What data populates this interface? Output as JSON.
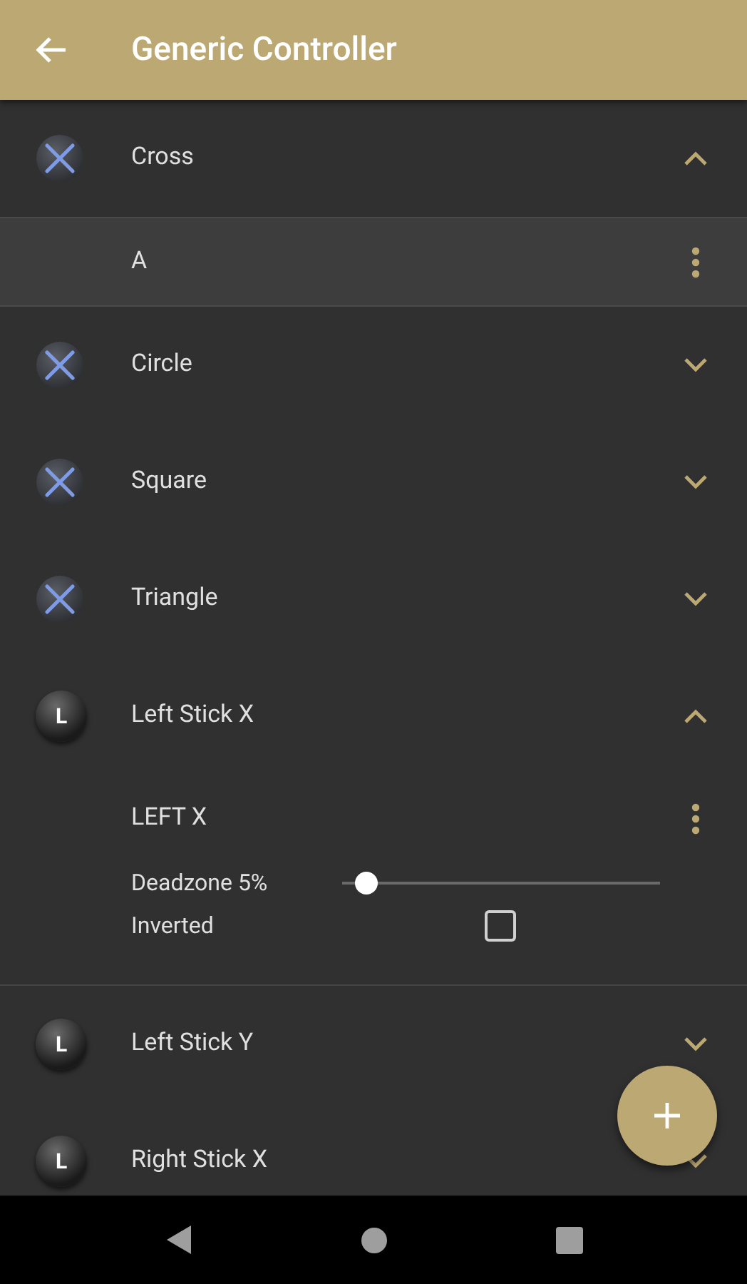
{
  "app_bar": {
    "title": "Generic Controller"
  },
  "inputs": [
    {
      "kind": "cross",
      "name": "Cross",
      "expanded": true,
      "bindings": [
        {
          "name": "A",
          "highlighted": true
        }
      ]
    },
    {
      "kind": "cross",
      "name": "Circle",
      "expanded": false
    },
    {
      "kind": "cross",
      "name": "Square",
      "expanded": false
    },
    {
      "kind": "cross",
      "name": "Triangle",
      "expanded": false
    },
    {
      "kind": "stick",
      "icon_letter": "L",
      "name": "Left Stick X",
      "expanded": true,
      "bindings": [
        {
          "name": "LEFT X",
          "highlighted": false,
          "deadzone": {
            "label": "Deadzone 5%",
            "level": 0.04
          },
          "inverted": {
            "label": "Inverted",
            "checked": false
          }
        }
      ]
    },
    {
      "kind": "stick",
      "icon_letter": "L",
      "name": "Left Stick Y",
      "expanded": false
    },
    {
      "kind": "stick",
      "icon_letter": "L",
      "name": "Right Stick X",
      "expanded": false
    }
  ]
}
